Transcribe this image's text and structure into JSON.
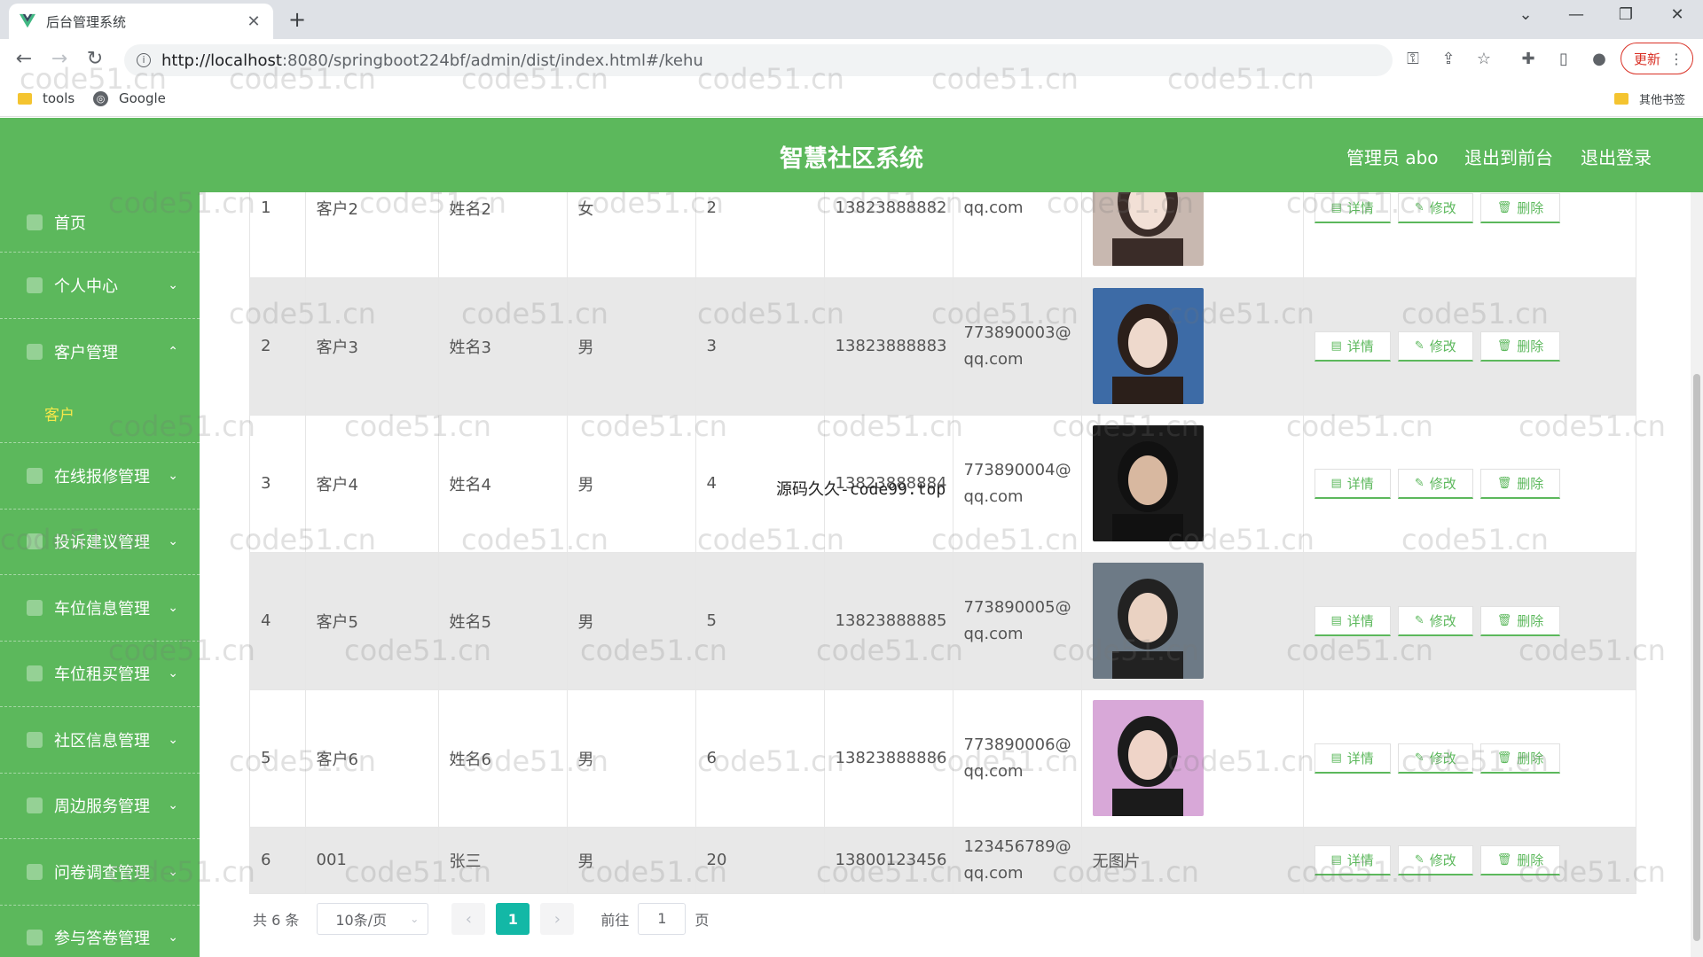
{
  "browser": {
    "tab_title": "后台管理系统",
    "url_host": "http://localhost",
    "url_rest": ":8080/springboot224bf/admin/dist/index.html#/kehu",
    "update_label": "更新",
    "bookmarks": [
      "tools",
      "Google"
    ],
    "other_bookmarks": "其他书签"
  },
  "header": {
    "title": "智慧社区系统",
    "admin": "管理员 abo",
    "to_front": "退出到前台",
    "logout": "退出登录"
  },
  "sidebar": {
    "items": [
      {
        "label": "首页"
      },
      {
        "label": "个人中心"
      },
      {
        "label": "客户管理"
      },
      {
        "label": "在线报修管理"
      },
      {
        "label": "投诉建议管理"
      },
      {
        "label": "车位信息管理"
      },
      {
        "label": "车位租买管理"
      },
      {
        "label": "社区信息管理"
      },
      {
        "label": "周边服务管理"
      },
      {
        "label": "问卷调查管理"
      },
      {
        "label": "参与答卷管理"
      }
    ],
    "submenu": "客户"
  },
  "table": {
    "rows": [
      {
        "idx": "1",
        "account": "客户2",
        "name": "姓名2",
        "gender": "女",
        "age": "2",
        "phone": "13823888882",
        "email1": "",
        "email2": "qq.com",
        "photo": true
      },
      {
        "idx": "2",
        "account": "客户3",
        "name": "姓名3",
        "gender": "男",
        "age": "3",
        "phone": "13823888883",
        "email1": "773890003@",
        "email2": "qq.com",
        "photo": true
      },
      {
        "idx": "3",
        "account": "客户4",
        "name": "姓名4",
        "gender": "男",
        "age": "4",
        "phone": "13823888884",
        "email1": "773890004@",
        "email2": "qq.com",
        "photo": true
      },
      {
        "idx": "4",
        "account": "客户5",
        "name": "姓名5",
        "gender": "男",
        "age": "5",
        "phone": "13823888885",
        "email1": "773890005@",
        "email2": "qq.com",
        "photo": true
      },
      {
        "idx": "5",
        "account": "客户6",
        "name": "姓名6",
        "gender": "男",
        "age": "6",
        "phone": "13823888886",
        "email1": "773890006@",
        "email2": "qq.com",
        "photo": true
      },
      {
        "idx": "6",
        "account": "001",
        "name": "张三",
        "gender": "男",
        "age": "20",
        "phone": "13800123456",
        "email1": "123456789@",
        "email2": "qq.com",
        "photo": false,
        "no_photo": "无图片"
      }
    ],
    "actions": {
      "detail": "详情",
      "edit": "修改",
      "delete": "删除"
    }
  },
  "pager": {
    "total": "共 6 条",
    "size": "10条/页",
    "current": "1",
    "goto_prefix": "前往",
    "goto_value": "1",
    "goto_suffix": "页"
  },
  "overlay": "源码久久-code99.top",
  "watermark": "code51.cn",
  "colors": {
    "brand": "#5cb85c",
    "active_sub": "#f6e84a",
    "pager_active": "#13b8a6"
  }
}
